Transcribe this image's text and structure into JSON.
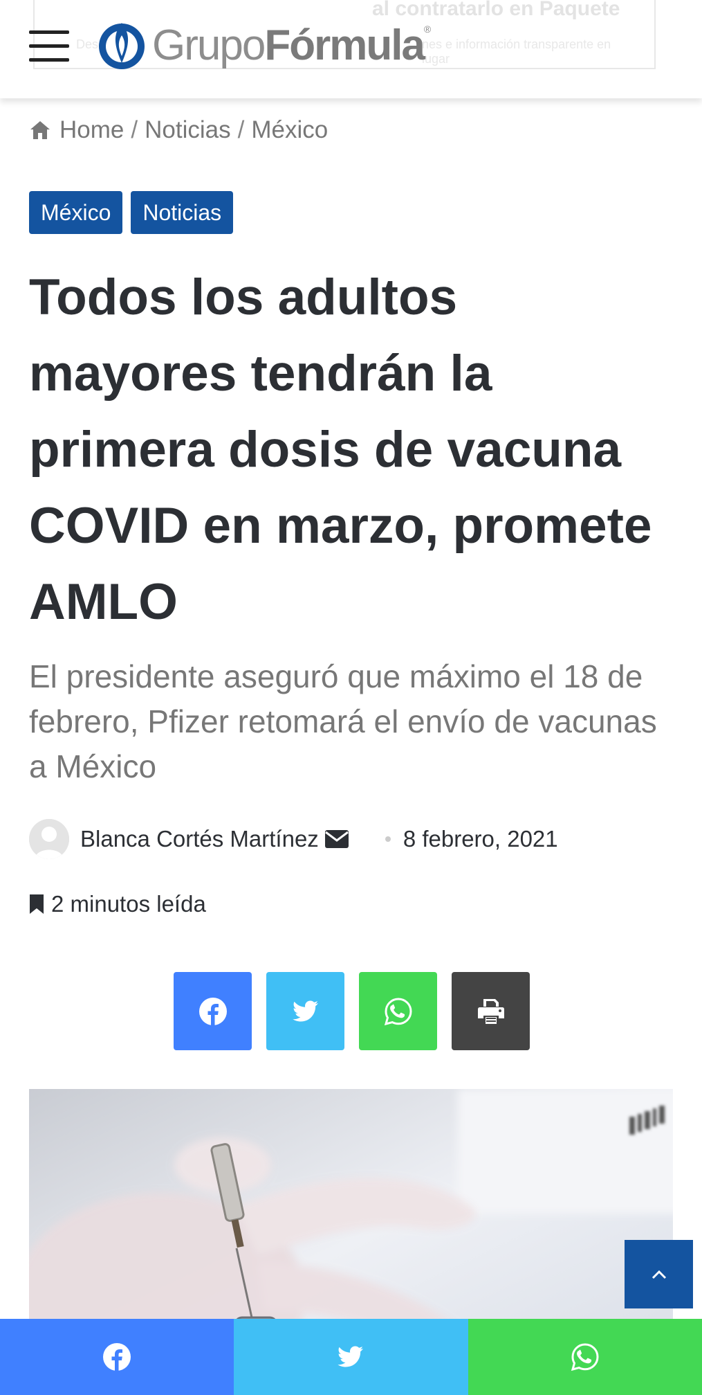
{
  "header": {
    "ghost_ad_title": "al contratarlo en Paquete",
    "ghost_ad_line_left": "Descu",
    "ghost_ad_line_right": "nes e información transparente en",
    "ghost_ad_line_right2": "lugar",
    "logo_grupo": "Grupo",
    "logo_formula": "Fórmula",
    "logo_registered": "®"
  },
  "breadcrumb": {
    "home": "Home",
    "separator": "/",
    "items": [
      "Noticias",
      "México"
    ]
  },
  "tags": [
    "México",
    "Noticias"
  ],
  "article": {
    "title": "Todos los adultos mayores tendrán la primera dosis de vacuna COVID en marzo, promete AMLO",
    "subtitle": "El presidente aseguró que máximo el 18 de febrero, Pfizer retomará el envío de vacunas a México",
    "author": "Blanca Cortés Martínez",
    "date": "8 febrero, 2021",
    "read_time": "2 minutos leída"
  },
  "share": {
    "facebook_color": "#4080ff",
    "twitter_color": "#40bff5",
    "whatsapp_color": "#43d854",
    "print_color": "#444444"
  },
  "icons": {
    "menu": "hamburger-icon",
    "home": "home-icon",
    "mail": "envelope-icon",
    "bookmark": "bookmark-icon",
    "facebook": "facebook-icon",
    "twitter": "twitter-icon",
    "whatsapp": "whatsapp-icon",
    "print": "printer-icon",
    "to_top": "chevron-up-icon"
  },
  "colors": {
    "brand_blue": "#1454a0",
    "text_dark": "#2c2f34",
    "text_muted": "#777777"
  }
}
